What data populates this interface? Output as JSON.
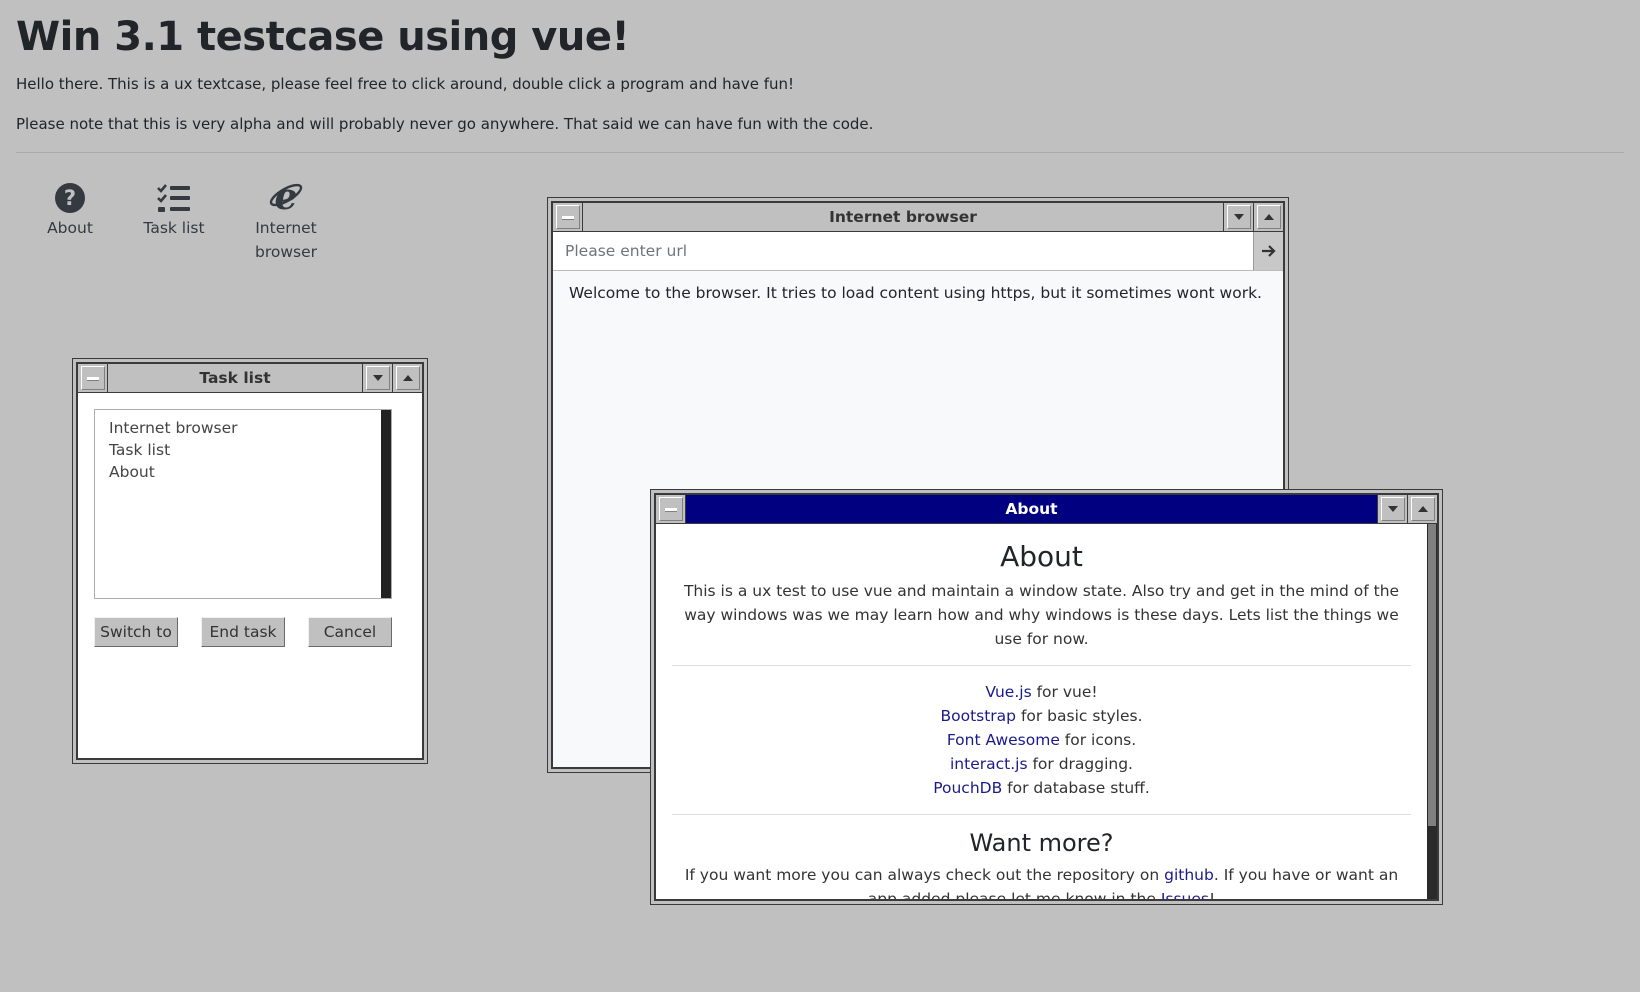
{
  "page": {
    "title": "Win 3.1 testcase using vue!",
    "intro1": "Hello there. This is a ux textcase, please feel free to click around, double click a program and have fun!",
    "intro2": "Please note that this is very alpha and will probably never go anywhere. That said we can have fun with the code."
  },
  "desktop": {
    "icons": [
      {
        "label": "About",
        "icon": "question-circle-icon"
      },
      {
        "label": "Task list",
        "icon": "tasks-icon"
      },
      {
        "label": "Internet browser",
        "icon": "internet-explorer-icon"
      }
    ]
  },
  "task_window": {
    "title": "Task list",
    "items": [
      "Internet browser",
      "Task list",
      "About"
    ],
    "buttons": {
      "switch": "Switch to",
      "end": "End task",
      "cancel": "Cancel"
    }
  },
  "browser_window": {
    "title": "Internet browser",
    "url_placeholder": "Please enter url",
    "url_value": "",
    "welcome": "Welcome to the browser. It tries to load content using https, but it sometimes wont work."
  },
  "about_window": {
    "title": "About",
    "heading": "About",
    "description": "This is a ux test to use vue and maintain a window state. Also try and get in the mind of the way windows was we may learn how and why windows is these days. Lets list the things we use for now.",
    "credits": [
      {
        "link": "Vue.js",
        "text": " for vue!"
      },
      {
        "link": "Bootstrap",
        "text": " for basic styles."
      },
      {
        "link": "Font Awesome",
        "text": " for icons."
      },
      {
        "link": "interact.js",
        "text": " for dragging."
      },
      {
        "link": "PouchDB",
        "text": " for database stuff."
      }
    ],
    "more_heading": "Want more?",
    "more_pre": "If you want more you can always check out the repository on ",
    "more_link1": "github",
    "more_mid": ". If you have or want an app added please let me know in the ",
    "more_link2": "Issues",
    "more_post": "!"
  },
  "colors": {
    "desktop": "#c0c0c0",
    "active_title": "#000080",
    "link": "#1a1a8c"
  }
}
